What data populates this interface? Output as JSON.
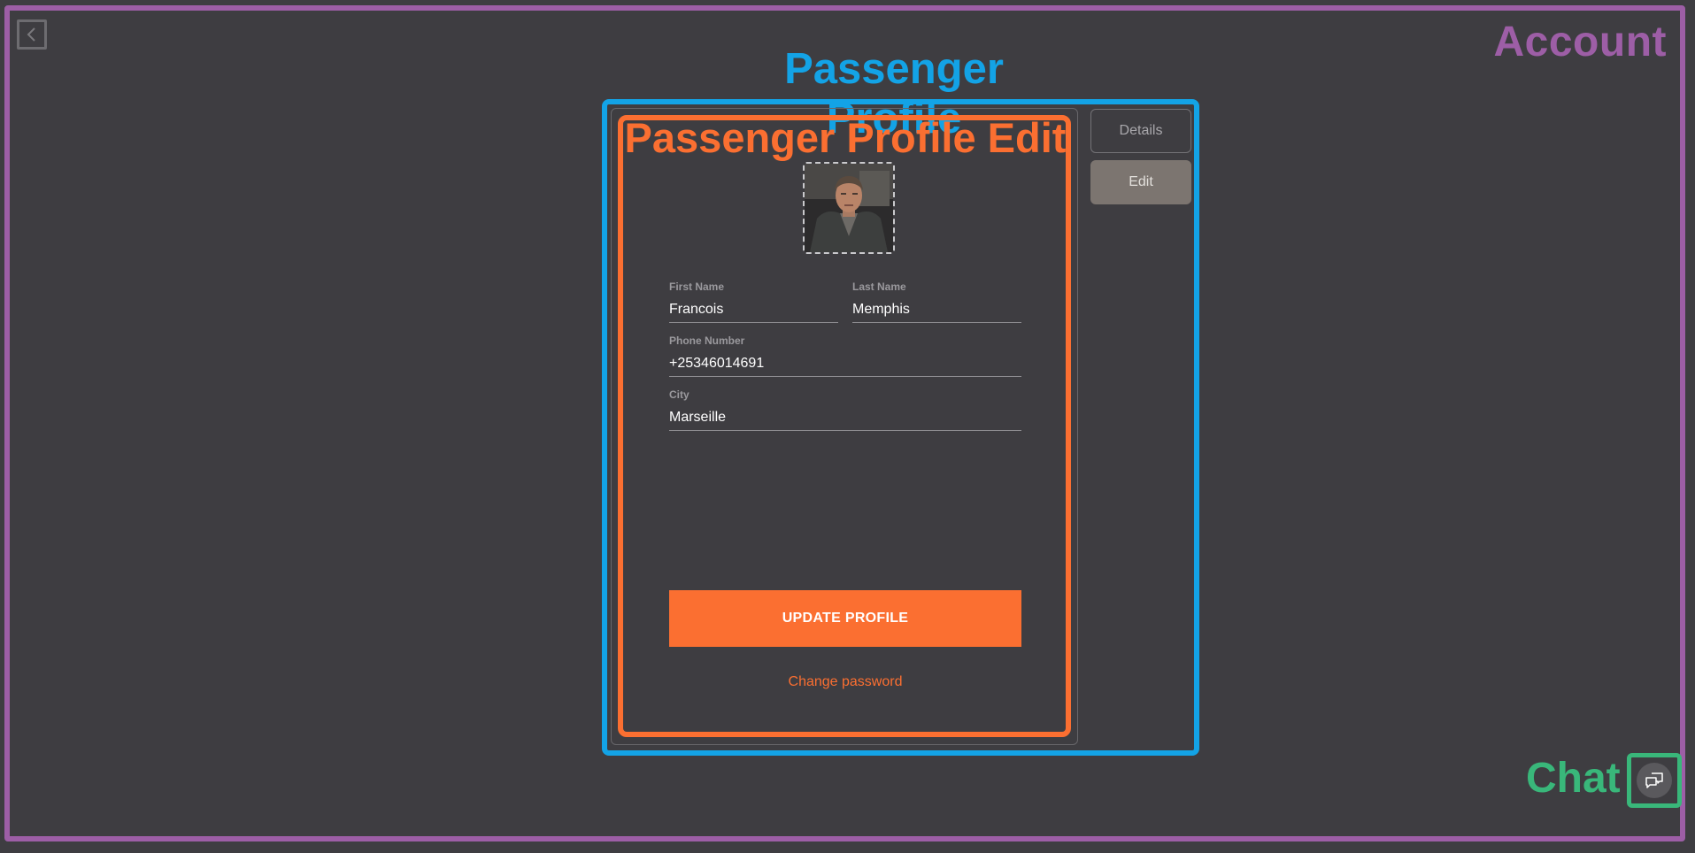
{
  "annotations": {
    "account": "Account",
    "passenger_profile": "Passenger Profile",
    "passenger_profile_edit": "Passenger Profile Edit",
    "chat": "Chat"
  },
  "form": {
    "first_name": {
      "label": "First Name",
      "value": "Francois"
    },
    "last_name": {
      "label": "Last Name",
      "value": "Memphis"
    },
    "phone": {
      "label": "Phone Number",
      "value": "+25346014691"
    },
    "city": {
      "label": "City",
      "value": "Marseille"
    }
  },
  "actions": {
    "update_label": "UPDATE PROFILE",
    "change_password_label": "Change password"
  },
  "tabs": [
    {
      "label": "Details",
      "active": false
    },
    {
      "label": "Edit",
      "active": true
    }
  ],
  "icons": {
    "back": "chevron-left-icon",
    "chat": "chat-bubbles-icon"
  },
  "colors": {
    "background": "#3e3d41",
    "account_outline": "#9d5ea6",
    "profile_outline": "#13a3e6",
    "edit_outline": "#fb6f31",
    "chat_outline": "#39b77a",
    "accent": "#fb6f31"
  }
}
